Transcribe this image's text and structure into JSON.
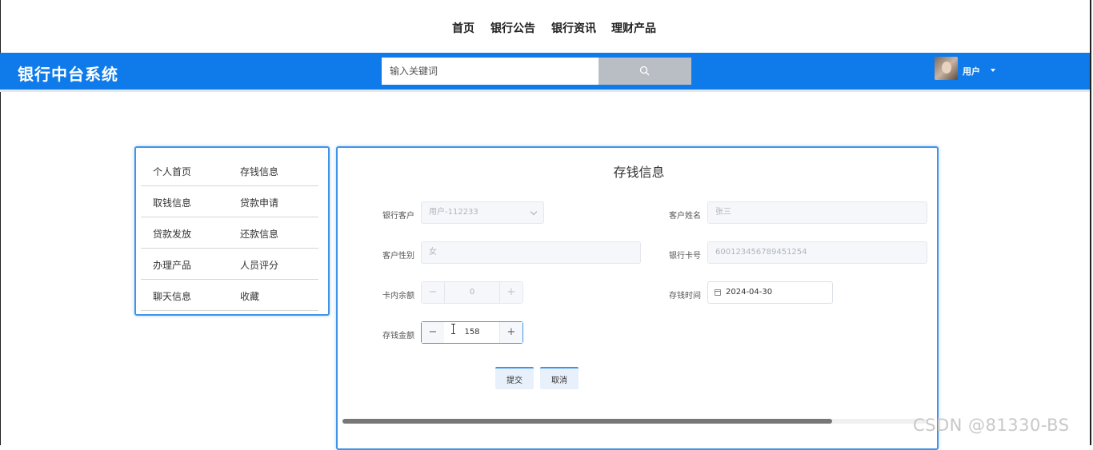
{
  "nav": [
    "首页",
    "银行公告",
    "银行资讯",
    "理财产品"
  ],
  "header": {
    "title": "银行中台系统",
    "search_placeholder": "输入关键词",
    "user_label": "用户"
  },
  "sidebar": {
    "rows": [
      [
        "个人首页",
        "存钱信息"
      ],
      [
        "取钱信息",
        "贷款申请"
      ],
      [
        "贷款发放",
        "还款信息"
      ],
      [
        "办理产品",
        "人员评分"
      ],
      [
        "聊天信息",
        "收藏"
      ]
    ]
  },
  "form": {
    "title": "存钱信息",
    "bank_customer_label": "银行客户",
    "bank_customer_value": "用户-112233",
    "customer_name_label": "客户姓名",
    "customer_name_value": "张三",
    "gender_label": "客户性别",
    "gender_value": "女",
    "card_label": "银行卡号",
    "card_value": "600123456789451254",
    "balance_label": "卡内余额",
    "balance_value": "0",
    "deposit_time_label": "存钱时间",
    "deposit_time_value": "2024-04-30",
    "amount_label": "存钱金额",
    "amount_value": "158",
    "submit_label": "提交",
    "cancel_label": "取消"
  },
  "watermark": "CSDN @81330-BS"
}
